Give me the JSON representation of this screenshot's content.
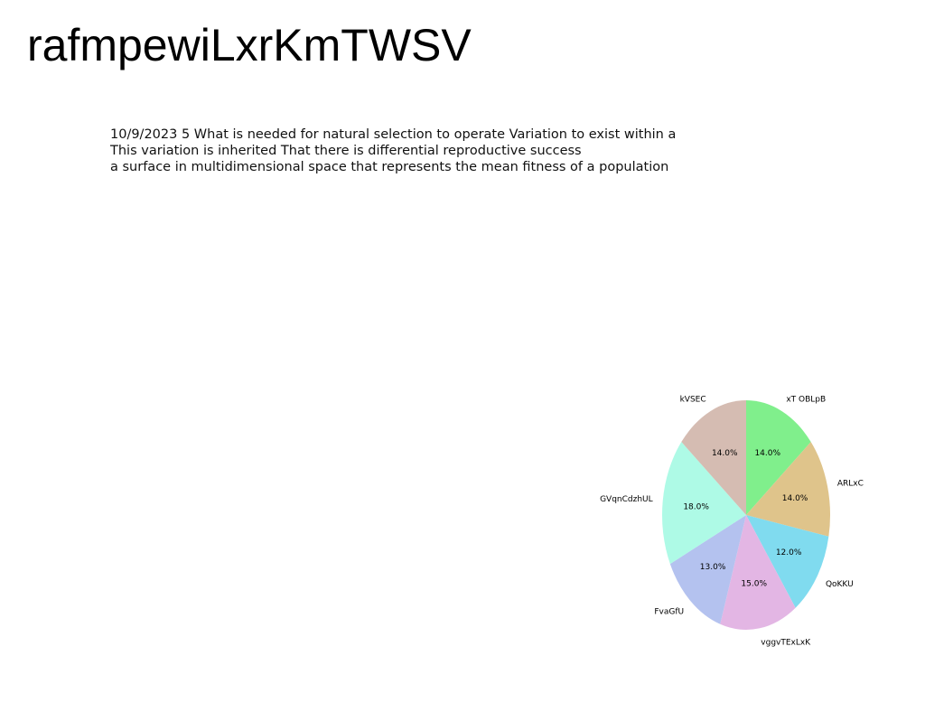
{
  "page": {
    "title": "rafmpewiLxrKmTWSV",
    "text_lines": [
      "10/9/2023 5 What is needed for natural selection to operate Variation to exist within a",
      "This variation is inherited That there is differential reproductive success",
      "a surface in multidimensional space that represents the mean fitness of a population"
    ]
  },
  "chart_data": {
    "type": "pie",
    "title": "",
    "start_angle_deg": 90,
    "direction": "clockwise",
    "slices": [
      {
        "label": "xT OBLpB",
        "value": 14.0,
        "pct_label": "14.0%",
        "color": "#80ef8c"
      },
      {
        "label": "ARLxC",
        "value": 14.0,
        "pct_label": "14.0%",
        "color": "#dfc48b"
      },
      {
        "label": "QoKKU",
        "value": 12.0,
        "pct_label": "12.0%",
        "color": "#80dbef"
      },
      {
        "label": "vggvTExLxK",
        "value": 15.0,
        "pct_label": "15.0%",
        "color": "#e3b6e4"
      },
      {
        "label": "FvaGfU",
        "value": 13.0,
        "pct_label": "13.0%",
        "color": "#b4c2ef"
      },
      {
        "label": "GVqnCdzhUL",
        "value": 18.0,
        "pct_label": "18.0%",
        "color": "#aefae6"
      },
      {
        "label": "kVSEC",
        "value": 14.0,
        "pct_label": "14.0%",
        "color": "#d5bcb2"
      }
    ]
  }
}
